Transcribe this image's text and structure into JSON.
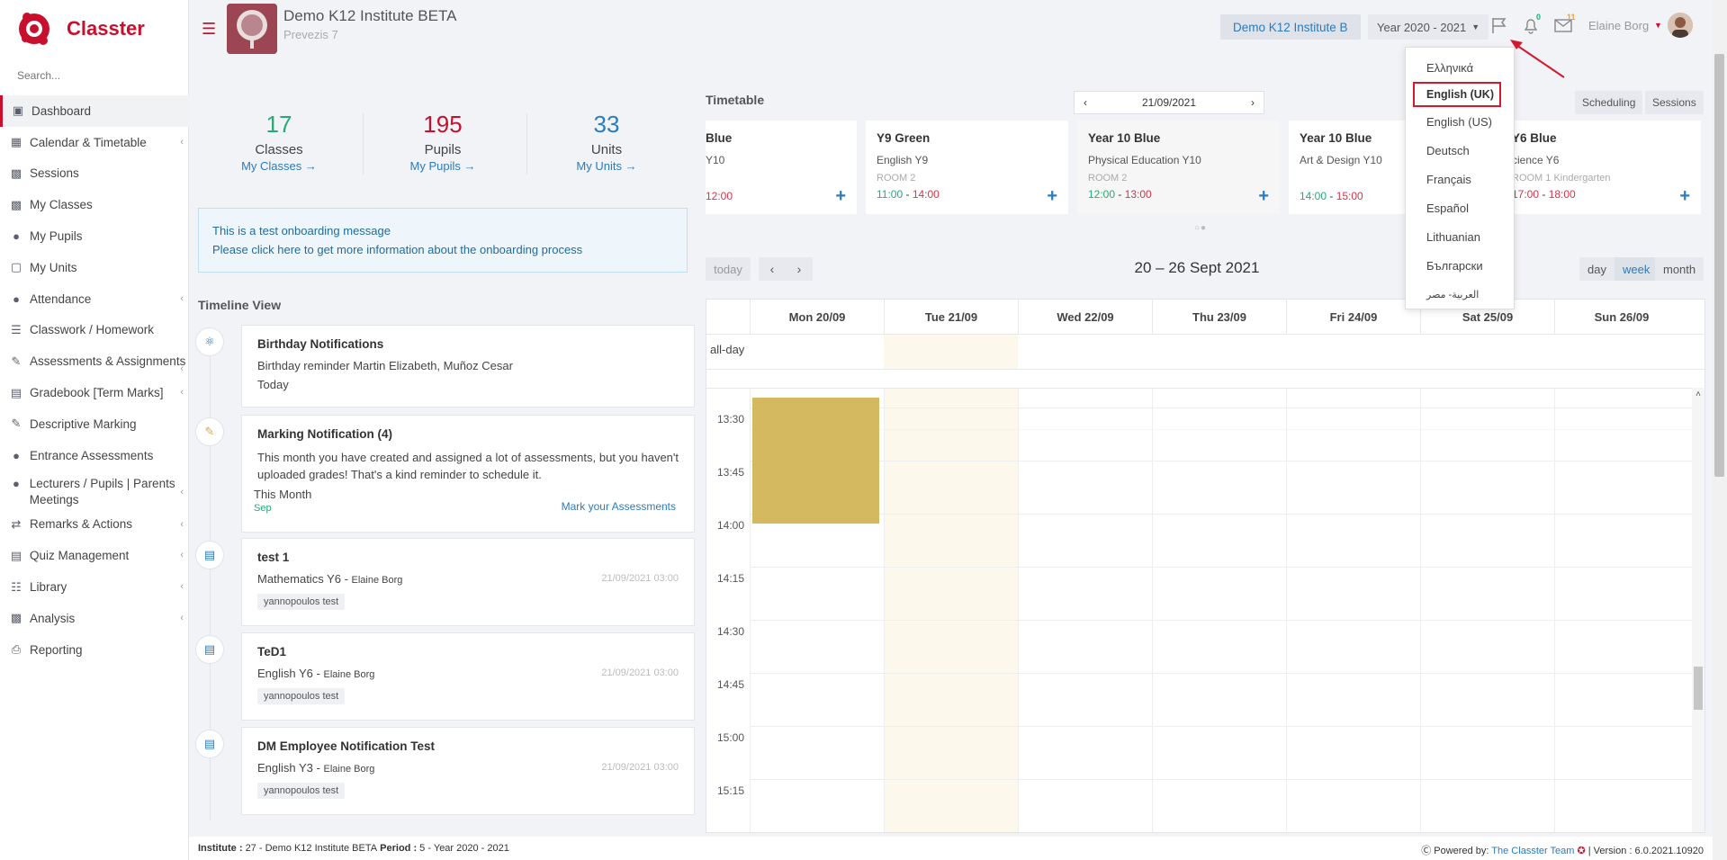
{
  "brand": {
    "name": "Classter",
    "color": "#c8102e"
  },
  "sidebar": {
    "search_placeholder": "Search...",
    "items": [
      {
        "label": "Dashboard",
        "icon": "laptop-icon",
        "active": true
      },
      {
        "label": "Calendar & Timetable",
        "icon": "calendar-icon",
        "has_sub": true
      },
      {
        "label": "Sessions",
        "icon": "sessions-icon"
      },
      {
        "label": "My Classes",
        "icon": "classes-icon"
      },
      {
        "label": "My Pupils",
        "icon": "pupils-icon"
      },
      {
        "label": "My Units",
        "icon": "book-icon"
      },
      {
        "label": "Attendance",
        "icon": "attendance-icon",
        "has_sub": true
      },
      {
        "label": "Classwork / Homework",
        "icon": "list-icon"
      },
      {
        "label": "Assessments & Assignments",
        "icon": "edit-icon",
        "has_sub": true
      },
      {
        "label": "Gradebook [Term Marks]",
        "icon": "gradebook-icon",
        "has_sub": true
      },
      {
        "label": "Descriptive Marking",
        "icon": "marking-icon"
      },
      {
        "label": "Entrance Assessments",
        "icon": "entrance-icon"
      },
      {
        "label": "Lecturers / Pupils | Parents Meetings",
        "icon": "meetings-icon",
        "has_sub": true
      },
      {
        "label": "Remarks & Actions",
        "icon": "shuffle-icon",
        "has_sub": true
      },
      {
        "label": "Quiz Management",
        "icon": "quiz-icon",
        "has_sub": true
      },
      {
        "label": "Library",
        "icon": "library-icon",
        "has_sub": true
      },
      {
        "label": "Analysis",
        "icon": "chart-icon",
        "has_sub": true
      },
      {
        "label": "Reporting",
        "icon": "printer-icon"
      }
    ]
  },
  "header": {
    "institute_name": "Demo K12 Institute BETA",
    "institute_sub": "Prevezis 7",
    "institute_button": "Demo K12 Institute B",
    "year": "Year 2020 - 2021",
    "notifications_count": "0",
    "messages_count": "11",
    "user_name": "Elaine Borg"
  },
  "stats": [
    {
      "number": "17",
      "label": "Classes",
      "link": "My Classes",
      "color": "#2aa876"
    },
    {
      "number": "195",
      "label": "Pupils",
      "link": "My Pupils",
      "color": "#c8102e"
    },
    {
      "number": "33",
      "label": "Units",
      "link": "My Units",
      "color": "#2b7bbd"
    }
  ],
  "onboarding": {
    "line1": "This is a test onboarding message",
    "line2": "Please click here to get more information about the onboarding process"
  },
  "timeline": {
    "title": "Timeline View",
    "items": [
      {
        "title": "Birthday Notifications",
        "body": "Birthday reminder Martin Elizabeth, Muñoz Cesar",
        "date": "Today"
      },
      {
        "title": "Marking Notification (4)",
        "body": "This month you have created and assigned a lot of assessments, but you haven't uploaded grades! That's a kind reminder to schedule it.",
        "date": "This Month",
        "sub": "Sep",
        "action": "Mark your Assessments"
      },
      {
        "title": "test 1",
        "subject": "Mathematics Y6",
        "by": "Elaine Borg",
        "time": "21/09/2021 03:00",
        "tag": "yannopoulos test"
      },
      {
        "title": "TeD1",
        "subject": "English Y6",
        "by": "Elaine Borg",
        "time": "21/09/2021 03:00",
        "tag": "yannopoulos test"
      },
      {
        "title": "DM Employee Notification Test",
        "subject": "English Y3",
        "by": "Elaine Borg",
        "time": "21/09/2021 03:00",
        "tag": "yannopoulos test"
      }
    ]
  },
  "timetable": {
    "title": "Timetable",
    "date": "21/09/2021",
    "tabs": [
      "Scheduling",
      "Sessions"
    ],
    "cards": [
      {
        "name": "Blue",
        "subject": "Y10",
        "room": "",
        "start": "",
        "end": "12:00"
      },
      {
        "name": "Y9 Green",
        "subject": "English Y9",
        "room": "ROOM 2",
        "start": "11:00",
        "end": "14:00"
      },
      {
        "name": "Year 10 Blue",
        "subject": "Physical Education Y10",
        "room": "ROOM 2",
        "start": "12:00",
        "end": "13:00"
      },
      {
        "name": "Year 10 Blue",
        "subject": "Art & Design Y10",
        "room": "",
        "start": "14:00",
        "end": "15:00"
      },
      {
        "name": "Y6 Blue",
        "subject": "cience Y6",
        "room": "ROOM 1 Kindergarten",
        "start": "17:00",
        "end": "18:00"
      }
    ]
  },
  "calendar": {
    "today_label": "today",
    "range": "20 – 26 Sept 2021",
    "views": [
      "day",
      "week",
      "month"
    ],
    "selected_view": "week",
    "days": [
      "Mon 20/09",
      "Tue 21/09",
      "Wed 22/09",
      "Thu 23/09",
      "Fri 24/09",
      "Sat 25/09",
      "Sun 26/09"
    ],
    "allday_label": "all-day",
    "times": [
      "13:30",
      "13:45",
      "14:00",
      "14:15",
      "14:30",
      "14:45",
      "15:00",
      "15:15"
    ],
    "event_color": "#d4b961"
  },
  "language_menu": {
    "items": [
      "Ελληνικά",
      "English (UK)",
      "English (US)",
      "Deutsch",
      "Français",
      "Español",
      "Lithuanian",
      "Български",
      "العربية- مصر"
    ],
    "selected": "English (UK)"
  },
  "footer": {
    "institute_label": "Institute :",
    "institute_value": "27 - Demo K12 Institute BETA",
    "period_label": "Period :",
    "period_value": "5 - Year 2020 - 2021",
    "powered_by": "Powered by:",
    "team": "The Classter Team",
    "version": "| Version : 6.0.2021.10920"
  }
}
